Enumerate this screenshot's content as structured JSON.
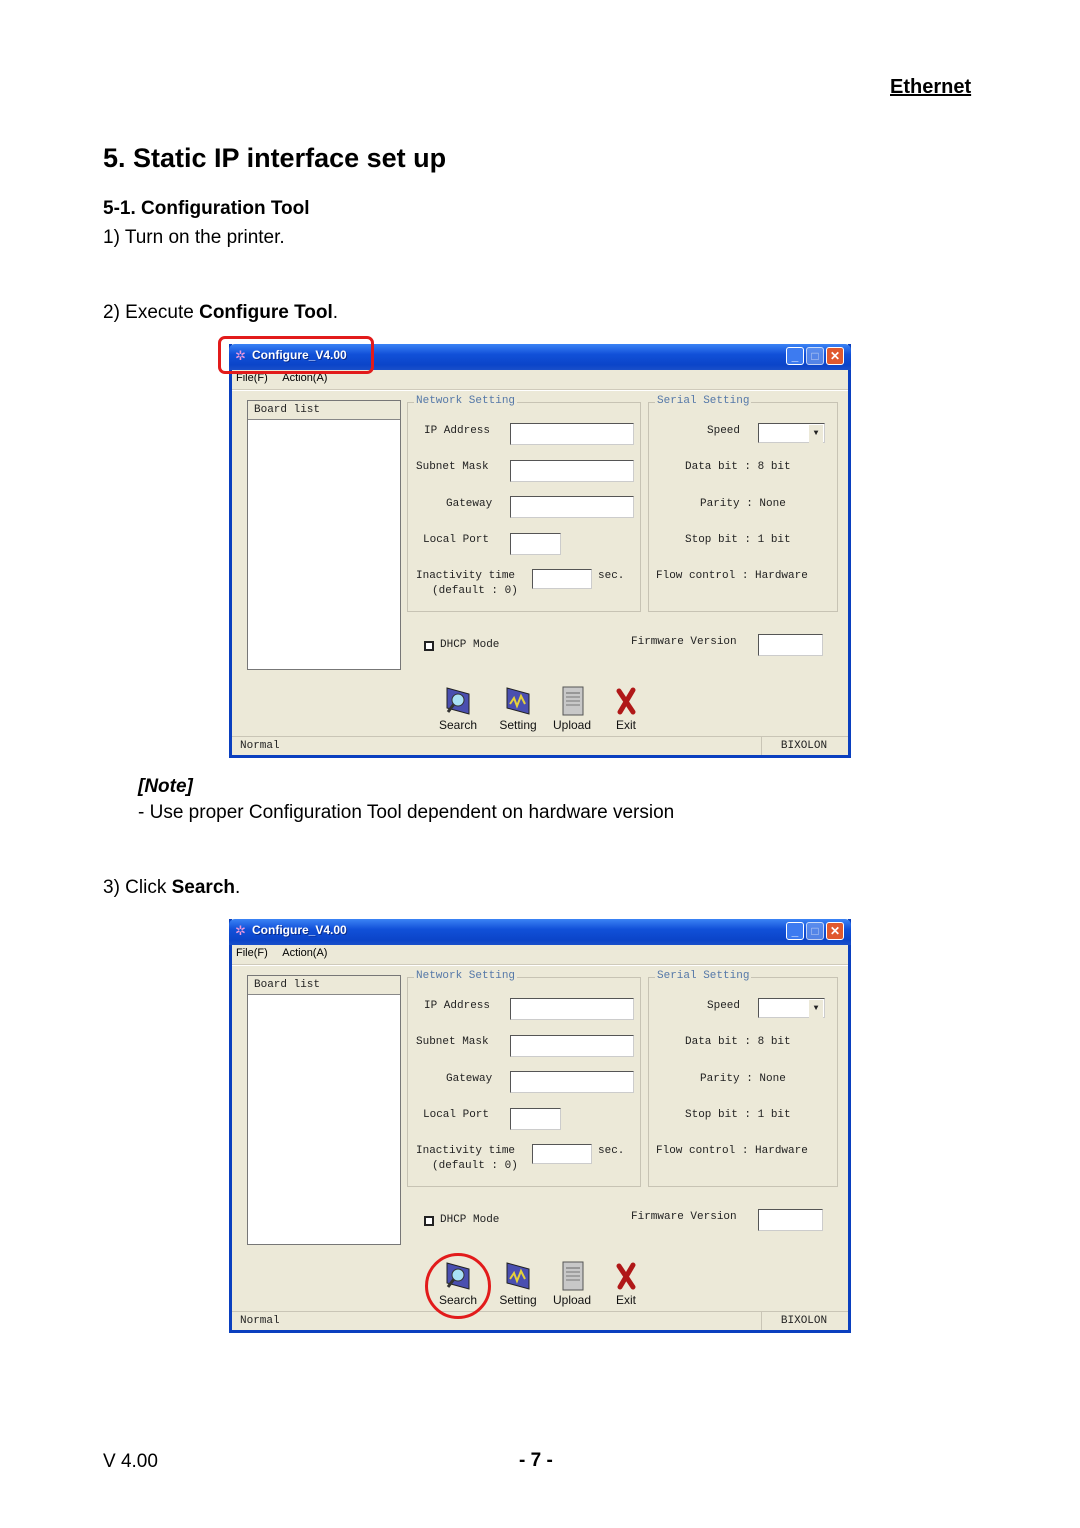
{
  "header": {
    "section_tag": "Ethernet"
  },
  "title": "5. Static IP interface set up",
  "subsection": "5-1. Configuration Tool",
  "steps": {
    "s1": "1) Turn on the printer.",
    "s2_prefix": "2) Execute ",
    "s2_bold": "Configure Tool",
    "s2_suffix": ".",
    "s3_prefix": "3) Click ",
    "s3_bold": "Search",
    "s3_suffix": "."
  },
  "note": {
    "title": "[Note]",
    "text": "- Use proper Configuration Tool dependent on hardware version"
  },
  "app": {
    "window_title": "Configure_V4.00",
    "menu": [
      "File(F)",
      "Action(A)"
    ],
    "board_list_header": "Board list",
    "network_group": "Network Setting",
    "network_fields": {
      "ip_address": {
        "label": "IP Address",
        "value": ""
      },
      "subnet_mask": {
        "label": "Subnet Mask",
        "value": ""
      },
      "gateway": {
        "label": "Gateway",
        "value": ""
      },
      "local_port": {
        "label": "Local Port",
        "value": ""
      },
      "inactivity": {
        "label": "Inactivity time",
        "value": "",
        "unit": "sec.",
        "hint": "(default : 0)"
      }
    },
    "serial_group": "Serial Setting",
    "serial": {
      "speed_label": "Speed",
      "speed_value": "",
      "data_bit": "Data bit : 8 bit",
      "parity": "Parity : None",
      "stop_bit": "Stop bit : 1 bit",
      "flow_control": "Flow control : Hardware"
    },
    "dhcp_label": "DHCP Mode",
    "dhcp_checked": false,
    "firmware_label": "Firmware Version",
    "firmware_value": "",
    "toolbar": [
      {
        "label": "Search",
        "icon": "search-icon"
      },
      {
        "label": "Setting",
        "icon": "setting-icon"
      },
      {
        "label": "Upload",
        "icon": "upload-icon"
      },
      {
        "label": "Exit",
        "icon": "exit-icon"
      }
    ],
    "status_left": "Normal",
    "status_right": "BIXOLON"
  },
  "footer": {
    "version": "V 4.00",
    "page": "- 7 -"
  }
}
